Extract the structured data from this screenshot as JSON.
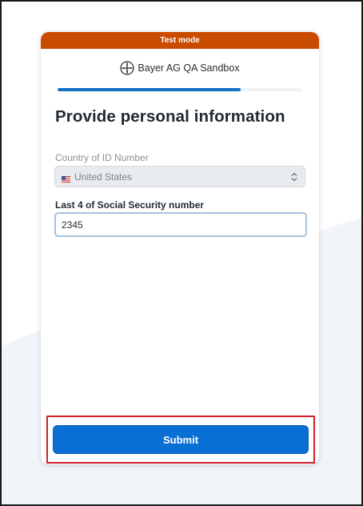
{
  "banner": {
    "label": "Test mode",
    "color": "#c94b00"
  },
  "brand": {
    "name": "Bayer AG QA Sandbox",
    "logo_icon": "bayer-cross-logo"
  },
  "progress": {
    "fraction": 0.75,
    "color": "#1170c4"
  },
  "form": {
    "heading": "Provide personal information",
    "country": {
      "label": "Country of ID Number",
      "selected": "United States",
      "flag_icon": "us-flag-icon"
    },
    "ssn": {
      "label": "Last 4 of Social Security number",
      "value": "2345"
    }
  },
  "submit": {
    "label": "Submit",
    "color": "#0a6fd4"
  },
  "highlight_color": "#d0202a"
}
